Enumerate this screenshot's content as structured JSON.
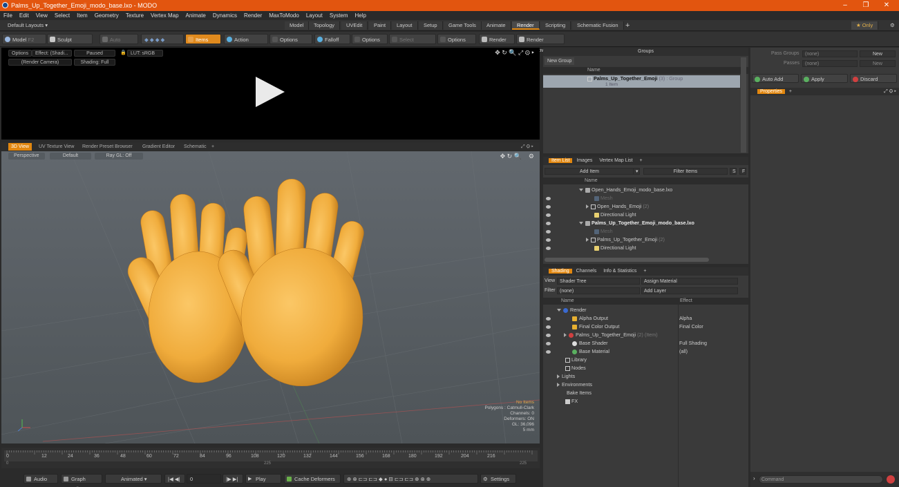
{
  "window": {
    "title": "Palms_Up_Together_Emoji_modo_base.lxo - MODO",
    "minimize": "–",
    "restore": "❐",
    "close": "✕"
  },
  "menu": [
    "File",
    "Edit",
    "View",
    "Select",
    "Item",
    "Geometry",
    "Texture",
    "Vertex Map",
    "Animate",
    "Dynamics",
    "Render",
    "MaxToModo",
    "Layout",
    "System",
    "Help"
  ],
  "layouts": {
    "default_label": "Default Layouts ▾",
    "tabs": [
      "Model",
      "Topology",
      "UVEdit",
      "Paint",
      "Layout",
      "Setup",
      "Game Tools",
      "Animate",
      "Render",
      "Scripting",
      "Schematic Fusion",
      "+"
    ],
    "active_tab": "Render",
    "only_label": "★ Only"
  },
  "toolbar": {
    "model": "Model",
    "model_key": "F2",
    "sculpt": "Sculpt",
    "auto_select": "Auto Select",
    "items": "Items",
    "action_center": "Action Center",
    "options1": "Options",
    "falloff": "Falloff",
    "options2": "Options",
    "select_through": "Select Through",
    "options3": "Options",
    "render": "Render",
    "render_key": "F9",
    "render_window": "Render Window"
  },
  "preview": {
    "options": "Options",
    "effect": "Effect: (Shadi...",
    "paused": "Paused",
    "lut": "LUT: sRGB",
    "camera": "(Render Camera)",
    "shading": "Shading: Full"
  },
  "viewport_tabs": [
    "3D View",
    "UV Texture View",
    "Render Preset Browser",
    "Gradient Editor",
    "Schematic",
    "+"
  ],
  "viewport": {
    "perspective": "Perspective",
    "default": "Default",
    "raygl": "Ray GL: Off",
    "hud": [
      "No Items",
      "Polygons : Catmull-Clark",
      "Channels: 0",
      "Deformers: ON",
      "GL: 36,096",
      "5 mm"
    ]
  },
  "timeline": {
    "ticks": [
      "0",
      "12",
      "24",
      "36",
      "48",
      "60",
      "72",
      "84",
      "96",
      "108",
      "120",
      "132",
      "144",
      "156",
      "168",
      "180",
      "192",
      "204",
      "216"
    ],
    "sub_ticks": [
      "0",
      "225",
      "225"
    ]
  },
  "bottom": {
    "audio": "Audio",
    "graph_editor": "Graph Editor",
    "animated": "Animated",
    "frame": "0",
    "play": "Play",
    "cache_deformers": "Cache Deformers",
    "settings": "Settings"
  },
  "groups": {
    "title": "Groups",
    "new_group": "New Group",
    "col_name": "Name",
    "row_name": "Palms_Up_Together_Emoji",
    "row_count": "(3) : Group",
    "row_sub": "1 Item"
  },
  "item_list": {
    "tabs": [
      "Item List",
      "Images",
      "Vertex Map List",
      "+"
    ],
    "add_item": "Add Item",
    "filter": "Filter Items",
    "s": "S",
    "f": "F",
    "col_name": "Name",
    "rows": [
      {
        "label": "Open_Hands_Emoji_modo_base.lxo",
        "kind": "scene",
        "bold": false
      },
      {
        "label": "Mesh",
        "kind": "mesh-dim",
        "bold": false
      },
      {
        "label": "Open_Hands_Emoji",
        "suffix": "(2)",
        "kind": "group",
        "bold": false
      },
      {
        "label": "Directional Light",
        "kind": "light",
        "bold": false
      },
      {
        "label": "Palms_Up_Together_Emoji_modo_base.lxo",
        "kind": "scene",
        "bold": true
      },
      {
        "label": "Mesh",
        "kind": "mesh-dim",
        "bold": false
      },
      {
        "label": "Palms_Up_Together_Emoji",
        "suffix": "(2)",
        "kind": "group",
        "bold": false
      },
      {
        "label": "Directional Light",
        "kind": "light",
        "bold": false
      }
    ]
  },
  "shading": {
    "tabs": [
      "Shading",
      "Channels",
      "Info & Statistics",
      "+"
    ],
    "view_label": "View",
    "view_value": "Shader Tree",
    "assign_material": "Assign Material",
    "filter_label": "Filter",
    "filter_value": "(none)",
    "add_layer": "Add Layer",
    "col_name": "Name",
    "col_effect": "Effect",
    "rows": [
      {
        "label": "Render",
        "effect": "",
        "indent": 0
      },
      {
        "label": "Alpha Output",
        "effect": "Alpha",
        "indent": 1
      },
      {
        "label": "Final Color Output",
        "effect": "Final Color",
        "indent": 1
      },
      {
        "label": "Palms_Up_Together_Emoji",
        "suffix": "(2) (Item)",
        "effect": "",
        "indent": 1
      },
      {
        "label": "Base Shader",
        "effect": "Full Shading",
        "indent": 1
      },
      {
        "label": "Base Material",
        "effect": "(all)",
        "indent": 1
      },
      {
        "label": "Library",
        "effect": "",
        "indent": 0
      },
      {
        "label": "Nodes",
        "effect": "",
        "indent": 0
      },
      {
        "label": "Lights",
        "effect": "",
        "indent": -1
      },
      {
        "label": "Environments",
        "effect": "",
        "indent": -1
      },
      {
        "label": "Bake Items",
        "effect": "",
        "indent": -1
      },
      {
        "label": "FX",
        "effect": "",
        "indent": -1
      }
    ]
  },
  "right_panel": {
    "pass_groups_label": "Pass Groups",
    "pass_groups_value": "(none)",
    "new": "New",
    "passes_label": "Passes",
    "passes_value": "(none)",
    "auto_add": "Auto Add",
    "apply": "Apply",
    "discard": "Discard",
    "properties": "Properties",
    "plus": "+",
    "command": "Command"
  },
  "colors": {
    "accent": "#e2870f",
    "title_bar": "#e2550f",
    "hand_skin": "#f0ac3c"
  }
}
